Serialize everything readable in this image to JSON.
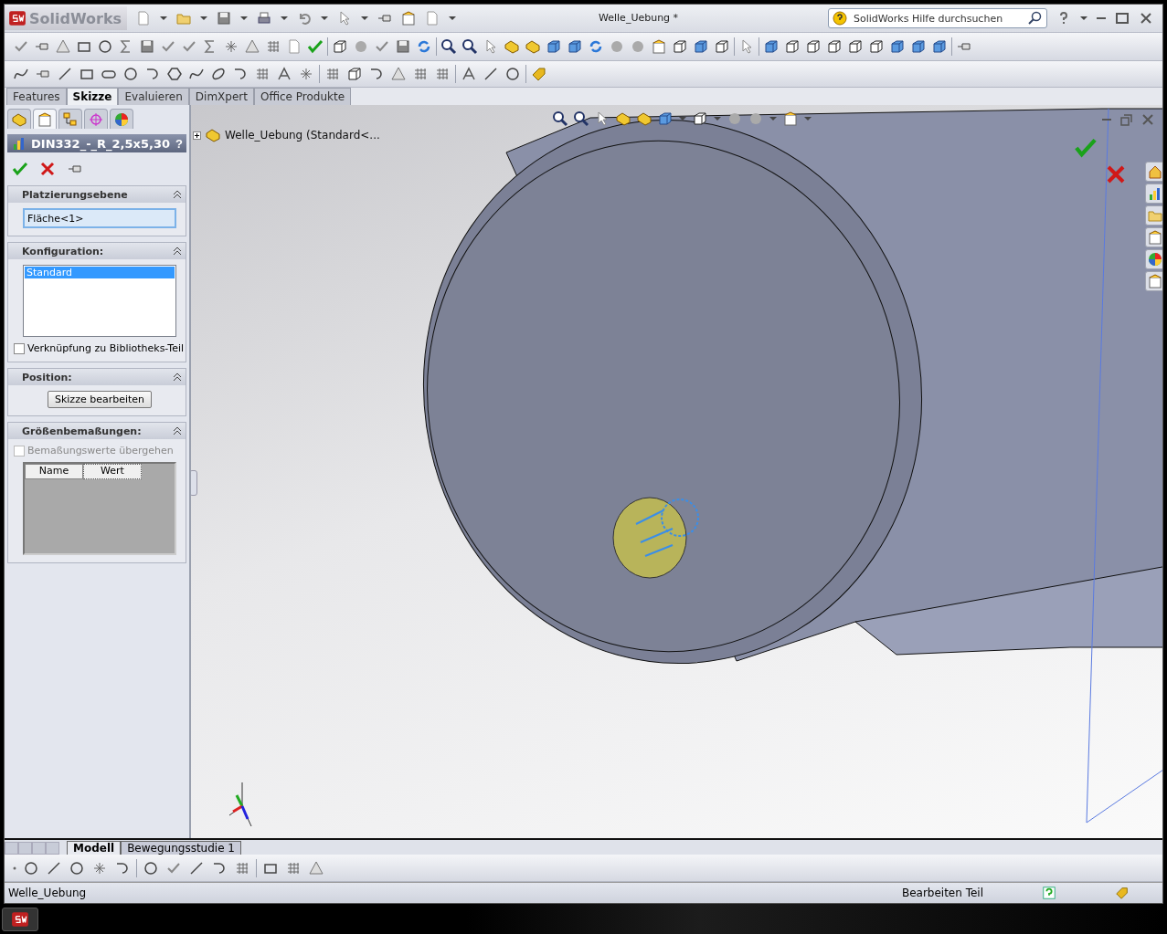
{
  "app": {
    "logo": "SolidWorks",
    "title": "Welle_Uebung *",
    "search": {
      "placeholder": "SolidWorks Hilfe durchsuchen"
    }
  },
  "command_tabs": [
    {
      "label": "Features",
      "selected": false
    },
    {
      "label": "Skizze",
      "selected": true
    },
    {
      "label": "Evaluieren",
      "selected": false
    },
    {
      "label": "DimXpert",
      "selected": false
    },
    {
      "label": "Office Produkte",
      "selected": false
    }
  ],
  "property_manager": {
    "panel_tabs": [
      {
        "selected": false
      },
      {
        "selected": true
      },
      {
        "selected": false
      },
      {
        "selected": false
      },
      {
        "selected": false
      }
    ],
    "title": "DIN332_-_R_2,5x5,30",
    "help": "?",
    "sections": [
      {
        "kind": "field",
        "title": "Platzierungsebene",
        "value": "Fläche<1>"
      },
      {
        "kind": "list",
        "title": "Konfiguration:",
        "items": [
          {
            "label": "Standard",
            "selected": true
          }
        ],
        "checkbox": {
          "label": "Verknüpfung zu Bibliotheks-Teil",
          "checked": false,
          "disabled": false
        }
      },
      {
        "kind": "button",
        "title": "Position:",
        "button": "Skizze bearbeiten"
      },
      {
        "kind": "table",
        "title": "Größenbemaßungen:",
        "checkbox": {
          "label": "Bemaßungswerte übergehen",
          "checked": false,
          "disabled": true
        },
        "columns": [
          "Name",
          "Wert"
        ]
      }
    ]
  },
  "tree": {
    "root": "Welle_Uebung  (Standard<...",
    "expanded": false
  },
  "bottom_tabs": [
    {
      "label": "Modell",
      "selected": true
    },
    {
      "label": "Bewegungsstudie 1",
      "selected": false
    }
  ],
  "status_bar": {
    "document": "Welle_Uebung",
    "mode": "Bearbeiten Teil"
  }
}
